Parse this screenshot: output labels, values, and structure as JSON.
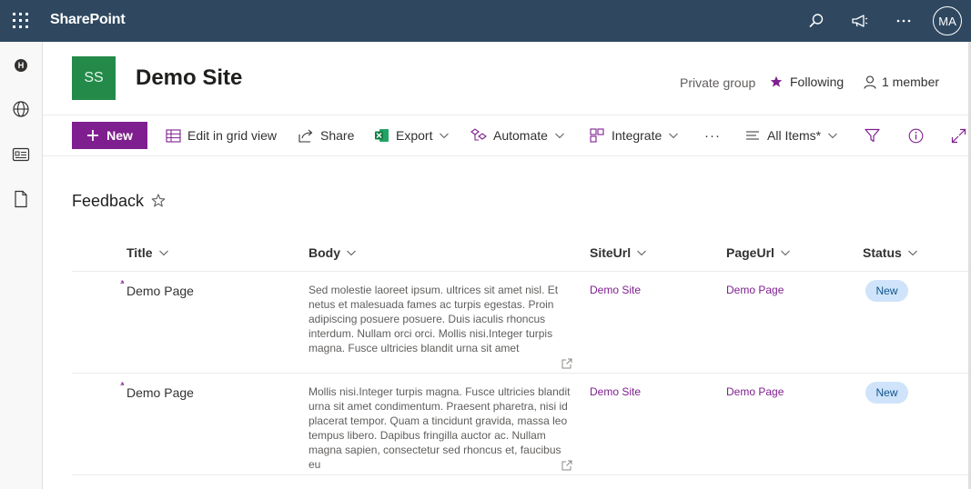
{
  "suite": {
    "brand": "SharePoint",
    "avatar_initials": "MA",
    "icons": [
      "waffle-icon",
      "search-icon",
      "megaphone-icon",
      "more-icon"
    ]
  },
  "site": {
    "logo_initials": "SS",
    "title": "Demo Site",
    "privacy": "Private group",
    "following": "Following",
    "members": "1 member"
  },
  "commands": {
    "new": "New",
    "edit_grid": "Edit in grid view",
    "share": "Share",
    "export": "Export",
    "automate": "Automate",
    "integrate": "Integrate",
    "more": "···",
    "view": "All Items*"
  },
  "list": {
    "title": "Feedback",
    "columns": [
      "Title",
      "Body",
      "SiteUrl",
      "PageUrl",
      "Status"
    ],
    "rows": [
      {
        "title": "Demo Page",
        "body": "Sed molestie laoreet ipsum. ultrices sit amet nisl. Et netus et malesuada fames ac turpis egestas. Proin adipiscing posuere posuere. Duis iaculis rhoncus interdum. Nullam orci orci. Mollis nisi.Integer turpis magna. Fusce ultricies blandit urna sit amet",
        "site_url": "Demo Site",
        "page_url": "Demo Page",
        "status": "New"
      },
      {
        "title": "Demo Page",
        "body": "Mollis nisi.Integer turpis magna. Fusce ultricies blandit urna sit amet condimentum. Praesent pharetra, nisi id placerat tempor. Quam a tincidunt gravida, massa leo tempus libero. Dapibus fringilla auctor ac. Nullam magna sapien, consectetur sed rhoncus et, faucibus eu",
        "site_url": "Demo Site",
        "page_url": "Demo Page",
        "status": "New"
      }
    ]
  },
  "colors": {
    "suitebar": "#2f4860",
    "accent": "#7f1f8f",
    "logo": "#238a49",
    "badge_bg": "#cfe4fa",
    "badge_text": "#0f548c"
  }
}
